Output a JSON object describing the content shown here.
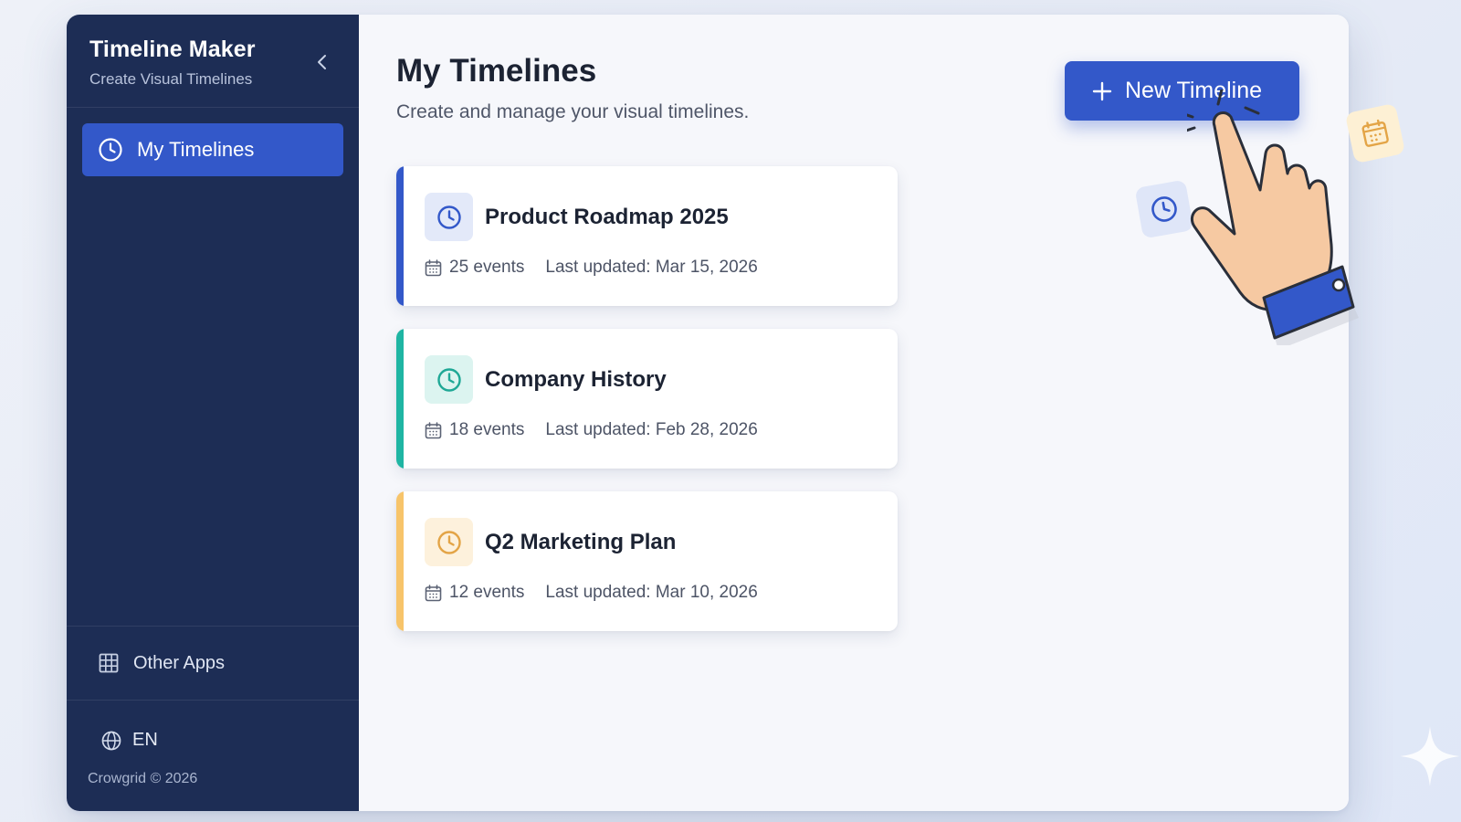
{
  "sidebar": {
    "app_title": "Timeline Maker",
    "app_subtitle": "Create Visual Timelines",
    "nav_items": [
      {
        "label": "My Timelines",
        "icon": "clock-icon",
        "active": true
      }
    ],
    "other_apps_label": "Other Apps",
    "language_label": "EN",
    "copyright": "Crowgrid © 2026"
  },
  "main": {
    "title": "My Timelines",
    "subtitle": "Create and manage your visual timelines.",
    "new_button_label": "New Timeline",
    "timelines": [
      {
        "title": "Product Roadmap 2025",
        "events": "25 events",
        "updated": "Last updated: Mar 15, 2026",
        "accent": "#3358c9",
        "icon_bg": "#e3e9f9",
        "icon_color": "#3358c9"
      },
      {
        "title": "Company History",
        "events": "18 events",
        "updated": "Last updated: Feb 28, 2026",
        "accent": "#1fb5a3",
        "icon_bg": "#dcf4f0",
        "icon_color": "#1fa896"
      },
      {
        "title": "Q2 Marketing Plan",
        "events": "12 events",
        "updated": "Last updated: Mar 10, 2026",
        "accent": "#f7c46a",
        "icon_bg": "#fdf1dc",
        "icon_color": "#e3a446"
      }
    ]
  },
  "colors": {
    "sidebar_bg": "#1d2d55",
    "primary": "#3358c9",
    "page_bg": "#f6f7fb"
  }
}
